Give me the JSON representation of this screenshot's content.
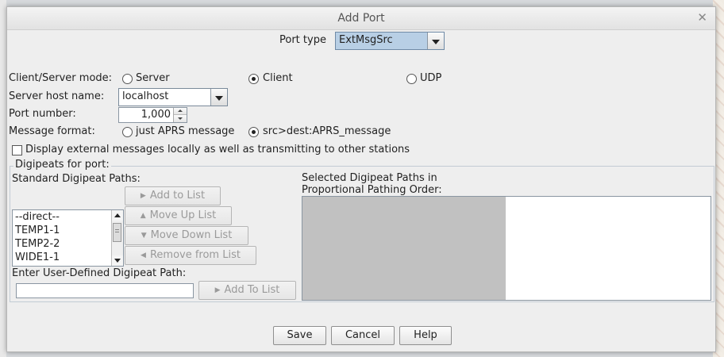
{
  "window": {
    "title": "Add Port"
  },
  "port_type": {
    "label": "Port type",
    "value": "ExtMsgSrc"
  },
  "mode": {
    "label": "Client/Server mode:",
    "options": [
      {
        "label": "Server",
        "selected": false
      },
      {
        "label": "Client",
        "selected": true
      },
      {
        "label": "UDP",
        "selected": false
      }
    ]
  },
  "server_host": {
    "label": "Server host name:",
    "value": "localhost"
  },
  "port_number": {
    "label": "Port number:",
    "value": "1,000"
  },
  "message_format": {
    "label": "Message format:",
    "options": [
      {
        "label": "just APRS message",
        "selected": false
      },
      {
        "label": "src>dest:APRS_message",
        "selected": true
      }
    ]
  },
  "display_local": {
    "label": "Display external messages locally as well as transmitting to other stations",
    "checked": false
  },
  "digipeats": {
    "group_label": "Digipeats for port:",
    "standard_label": "Standard Digipeat Paths:",
    "standard_paths": [
      "--direct--",
      "TEMP1-1",
      "TEMP2-2",
      "WIDE1-1"
    ],
    "selected_label_line1": "Selected Digipeat Paths in",
    "selected_label_line2": "Proportional Pathing Order:",
    "buttons": {
      "add": "Add to List",
      "move_up": "Move Up List",
      "move_down": "Move Down List",
      "remove": "Remove from List"
    },
    "user_defined_label": "Enter User-Defined Digipeat Path:",
    "user_defined_value": "",
    "add_user_button": "Add To List"
  },
  "footer": {
    "save": "Save",
    "cancel": "Cancel",
    "help": "Help"
  },
  "colors": {
    "port_type_highlight": "#b8cfe5",
    "selected_panel_gray": "#c1c1c1"
  }
}
